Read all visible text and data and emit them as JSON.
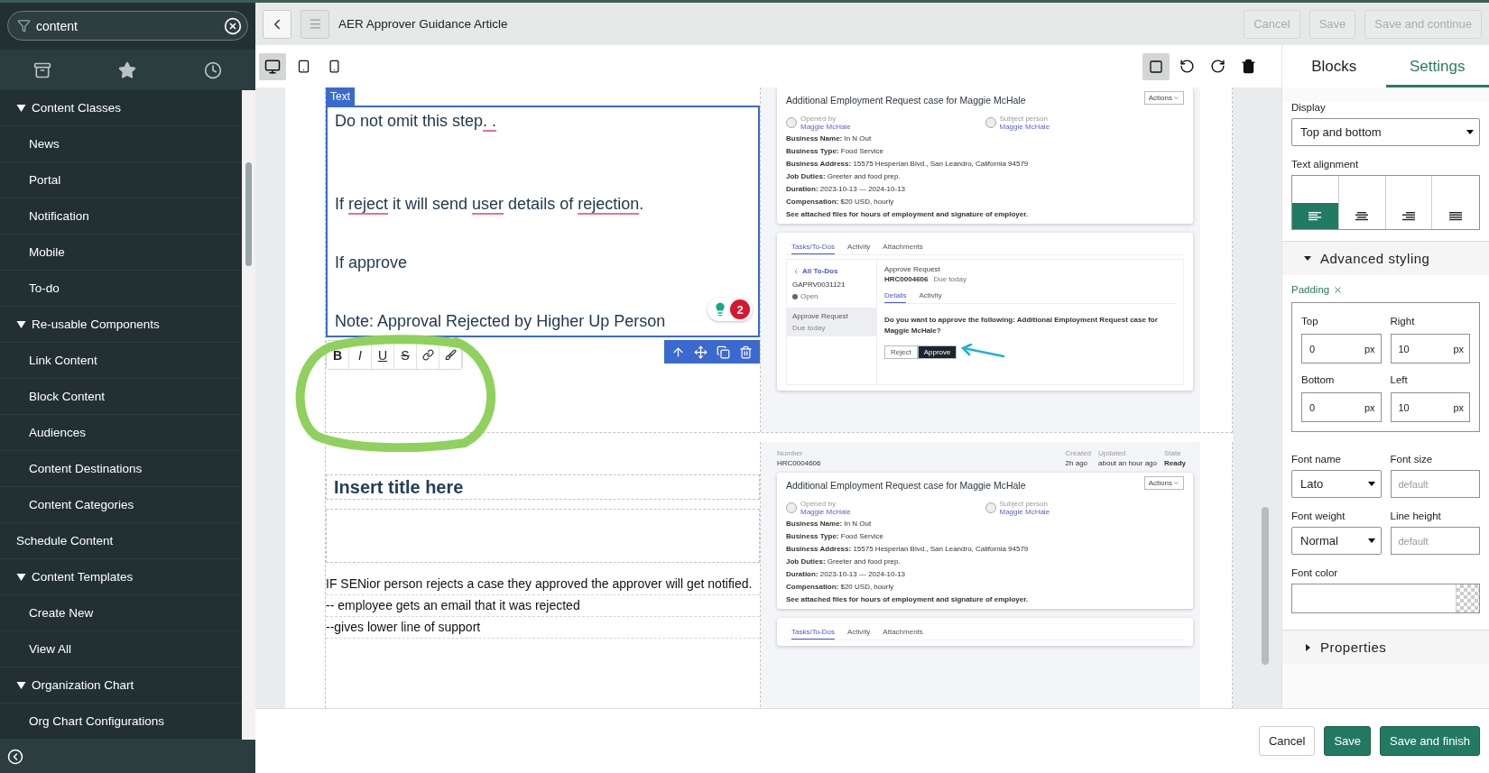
{
  "sidebar": {
    "search": {
      "value": "content"
    },
    "nav": [
      {
        "label": "Content Classes",
        "expanded": true,
        "children": [
          {
            "label": "News"
          },
          {
            "label": "Portal"
          },
          {
            "label": "Notification"
          },
          {
            "label": "Mobile"
          },
          {
            "label": "To-do"
          }
        ]
      },
      {
        "label": "Re-usable Components",
        "expanded": true,
        "children": [
          {
            "label": "Link Content"
          },
          {
            "label": "Block Content"
          },
          {
            "label": "Audiences"
          },
          {
            "label": "Content Destinations"
          },
          {
            "label": "Content Categories"
          }
        ]
      },
      {
        "label": "Schedule Content"
      },
      {
        "label": "Content Templates",
        "expanded": true,
        "children": [
          {
            "label": "Create New"
          },
          {
            "label": "View All"
          }
        ]
      },
      {
        "label": "Organization Chart",
        "expanded": true,
        "children": [
          {
            "label": "Org Chart Configurations"
          }
        ]
      }
    ]
  },
  "header": {
    "title": "AER Approver Guidance Article",
    "buttons": [
      {
        "label": "Cancel",
        "disabled": true
      },
      {
        "label": "Save",
        "disabled": true
      },
      {
        "label": "Save and continue",
        "disabled": true
      }
    ]
  },
  "devices": [
    {
      "kind": "desktop",
      "selected": true
    },
    {
      "kind": "tablet",
      "selected": false
    },
    {
      "kind": "mobile",
      "selected": false
    }
  ],
  "editor": {
    "text_block": {
      "tag": "Text",
      "paragraphs": [
        [
          {
            "text": "Do not omit this step"
          },
          {
            "text": ". .",
            "flagged": true
          }
        ],
        [
          {
            "text": "If "
          },
          {
            "text": "reject",
            "flagged": true
          },
          {
            "text": " it will send "
          },
          {
            "text": "user",
            "flagged": true
          },
          {
            "text": " details of "
          },
          {
            "text": "rejection",
            "flagged": true
          },
          {
            "text": "."
          }
        ],
        [
          {
            "text": "If approve"
          }
        ],
        [
          {
            "text": "Note: Approval Rejected by Higher Up Person"
          }
        ]
      ],
      "issues": "2",
      "format_buttons": [
        "B",
        "I",
        "U",
        "S"
      ]
    },
    "second_block": {
      "title": "Insert title here",
      "lines": [
        "IF SENior person rejects a case they approved the approver will get notified.",
        "-- employee gets an email that it was rejected",
        "--gives lower line of support"
      ]
    },
    "screenshots": [
      {
        "case_card": {
          "title": "Additional Employment Request case for Maggie McHale",
          "actions": "Actions",
          "people": [
            {
              "label": "Opened by",
              "name": "Maggie McHale"
            },
            {
              "label": "Subject person",
              "name": "Maggie McHale"
            }
          ],
          "details": [
            "**Business Name:** In N Out",
            "**Business Type:** Food Service",
            "**Business Address:** 15575 Hesperian Blvd., San Leandro, California 94579",
            "**Job Duties:** Greeter and food prep.",
            "**Duration:** 2023-10-13 --- 2024-10-13",
            "**Compensation:** $20 USD, hourly"
          ],
          "note": "See attached files for hours of employment and signature of employer."
        },
        "tasks": {
          "tabs": [
            {
              "label": "Tasks/To-Dos",
              "selected": true
            },
            {
              "label": "Activity",
              "selected": false
            },
            {
              "label": "Attachments",
              "selected": false
            }
          ],
          "todo": {
            "back": "All To-Dos",
            "id": "GAPRV0031121",
            "status": "Open",
            "items": [
              {
                "title": "Approve Request",
                "due": "Due today",
                "selected": true
              }
            ],
            "detail": {
              "title": "Approve Request",
              "number": "HRC0004606",
              "due": "Due today",
              "tabs": [
                {
                  "label": "Details",
                  "selected": true
                },
                {
                  "label": "Activity",
                  "selected": false
                }
              ],
              "question": "Do you want to approve the following: Additional Employment Request case for Maggie McHale?",
              "buttons": [
                {
                  "label": "Reject",
                  "kind": "secondary"
                },
                {
                  "label": "Approve",
                  "kind": "primary"
                }
              ]
            }
          }
        }
      },
      {
        "record": {
          "number_label": "Number",
          "number": "HRC0004606",
          "meta": [
            {
              "label": "Created",
              "value": "2h ago"
            },
            {
              "label": "Updated",
              "value": "about an hour ago"
            },
            {
              "label": "State",
              "value": "Ready"
            }
          ]
        },
        "case_card": {
          "title": "Additional Employment Request case for Maggie McHale",
          "actions": "Actions",
          "people": [
            {
              "label": "Opened by",
              "name": "Maggie McHale"
            },
            {
              "label": "Subject person",
              "name": "Maggie McHale"
            }
          ],
          "details": [
            "**Business Name:** In N Out",
            "**Business Type:** Food Service",
            "**Business Address:** 15575 Hesperian Blvd., San Leandro, California 94579",
            "**Job Duties:** Greeter and food prep.",
            "**Duration:** 2023-10-13 --- 2024-10-13",
            "**Compensation:** $20 USD, hourly"
          ],
          "note": "See attached files for hours of employment and signature of employer."
        },
        "tasks": {
          "tabs": [
            {
              "label": "Tasks/To-Dos",
              "selected": true
            },
            {
              "label": "Activity",
              "selected": false
            },
            {
              "label": "Attachments",
              "selected": false
            }
          ]
        }
      }
    ]
  },
  "panel": {
    "tabs": [
      {
        "label": "Blocks",
        "selected": false
      },
      {
        "label": "Settings",
        "selected": true
      }
    ],
    "display": {
      "label": "Display",
      "value": "Top and bottom"
    },
    "alignment": {
      "label": "Text alignment",
      "options": [
        {
          "kind": "left",
          "selected": true
        },
        {
          "kind": "center",
          "selected": false
        },
        {
          "kind": "right",
          "selected": false
        },
        {
          "kind": "justify",
          "selected": false
        }
      ]
    },
    "advanced": {
      "label": "Advanced styling",
      "expanded": true
    },
    "padding": {
      "label": "Padding",
      "fields": [
        {
          "label": "Top",
          "value": "0",
          "unit": "px"
        },
        {
          "label": "Right",
          "value": "10",
          "unit": "px"
        },
        {
          "label": "Bottom",
          "value": "0",
          "unit": "px"
        },
        {
          "label": "Left",
          "value": "10",
          "unit": "px"
        }
      ]
    },
    "font": [
      {
        "label": "Font name",
        "kind": "select",
        "value": "Lato"
      },
      {
        "label": "Font size",
        "kind": "input",
        "placeholder": "default"
      },
      {
        "label": "Font weight",
        "kind": "select",
        "value": "Normal"
      },
      {
        "label": "Line height",
        "kind": "input",
        "placeholder": "default"
      }
    ],
    "font_color": {
      "label": "Font color"
    },
    "properties": {
      "label": "Properties",
      "expanded": false
    }
  },
  "footer": {
    "buttons": [
      {
        "label": "Cancel",
        "kind": "secondary"
      },
      {
        "label": "Save",
        "kind": "primary"
      },
      {
        "label": "Save and finish",
        "kind": "primary"
      }
    ]
  }
}
